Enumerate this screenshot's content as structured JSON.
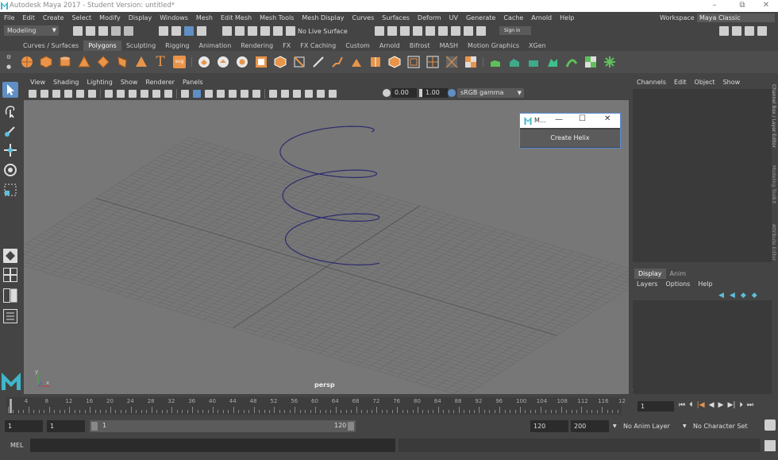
{
  "window": {
    "title": "Autodesk Maya 2017 - Student Version: untitled*",
    "controls": [
      "–",
      "⧉",
      "✕"
    ]
  },
  "menubar": {
    "items": [
      "File",
      "Edit",
      "Create",
      "Select",
      "Modify",
      "Display",
      "Windows",
      "Mesh",
      "Edit Mesh",
      "Mesh Tools",
      "Mesh Display",
      "Curves",
      "Surfaces",
      "Deform",
      "UV",
      "Generate",
      "Cache",
      "Arnold",
      "Help"
    ],
    "workspace_label": "Workspace :",
    "workspace_value": "Maya Classic"
  },
  "statusline": {
    "mode": "Modeling",
    "live_surface": "No Live Surface",
    "signin": "Sign in"
  },
  "shelf": {
    "tabs": [
      "Curves / Surfaces",
      "Polygons",
      "Sculpting",
      "Rigging",
      "Animation",
      "Rendering",
      "FX",
      "FX Caching",
      "Custom",
      "Arnold",
      "Bifrost",
      "MASH",
      "Motion Graphics",
      "XGen"
    ],
    "active_tab": "Polygons",
    "text_tool_label": "T",
    "svg_label": "svg"
  },
  "viewport": {
    "menu": [
      "View",
      "Shading",
      "Lighting",
      "Show",
      "Renderer",
      "Panels"
    ],
    "near_value": "0.00",
    "exposure_value": "1.00",
    "color_space": "sRGB gamma",
    "camera_label": "persp",
    "axis_y": "y",
    "axis_x": "x"
  },
  "dialog": {
    "title": "M...",
    "button_label": "Create Helix",
    "controls": [
      "—",
      "☐",
      "✕"
    ]
  },
  "channelbox": {
    "menu": [
      "Channels",
      "Edit",
      "Object",
      "Show"
    ]
  },
  "side_tabs": [
    "Channel Box / Layer Editor",
    "Modeling Toolkit",
    "Attribute Editor"
  ],
  "layereditor": {
    "tabs": [
      "Display",
      "Anim"
    ],
    "menu": [
      "Layers",
      "Options",
      "Help"
    ]
  },
  "timeslider": {
    "ticks": [
      "4",
      "8",
      "12",
      "16",
      "20",
      "24",
      "28",
      "32",
      "36",
      "40",
      "44",
      "48",
      "52",
      "56",
      "60",
      "64",
      "68",
      "72",
      "76",
      "80",
      "84",
      "88",
      "92",
      "96",
      "100",
      "104",
      "108",
      "112",
      "116",
      "12"
    ],
    "current_frame": "1"
  },
  "rangeslider": {
    "start": "1",
    "anim_start": "1",
    "range_start": "1",
    "range_end": "120",
    "end": "120",
    "anim_end": "200",
    "anim_layer": "No Anim Layer",
    "character_set": "No Character Set"
  },
  "cmdline": {
    "label": "MEL"
  },
  "colors": {
    "bg": "#444444",
    "viewport": "#777777",
    "grid": "#6a6a6a",
    "helix": "#2c2c6e",
    "shelf_icon": "#e8944a",
    "maya_logo": "#3fb7c9"
  }
}
